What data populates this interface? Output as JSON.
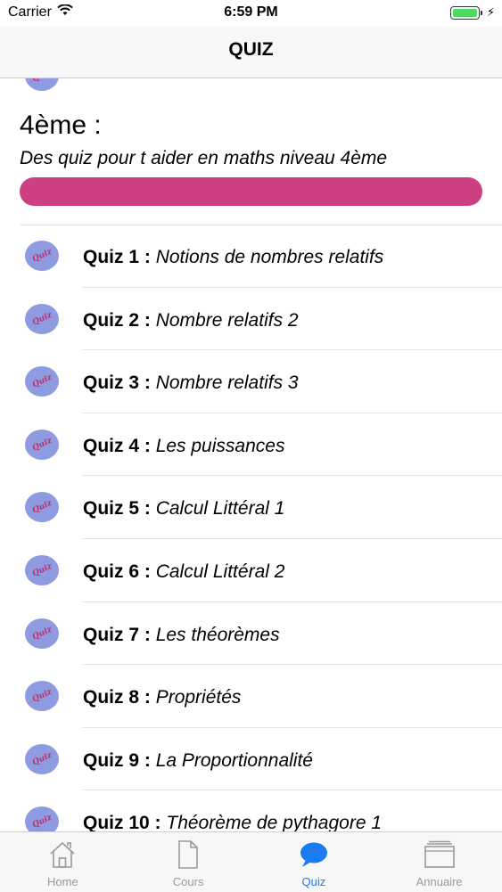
{
  "status_bar": {
    "carrier": "Carrier",
    "time": "6:59 PM"
  },
  "nav": {
    "title": "QUIZ"
  },
  "section": {
    "title": "4ème :",
    "subtitle": "Des quiz pour t aider en maths niveau 4ème",
    "progress_color": "#cc4081"
  },
  "avatar_text": "Quiz",
  "quizzes": [
    {
      "prefix": "Quiz 1 :",
      "title": "Notions de nombres relatifs"
    },
    {
      "prefix": "Quiz 2 :",
      "title": "Nombre relatifs 2"
    },
    {
      "prefix": "Quiz 3 :",
      "title": "Nombre relatifs 3"
    },
    {
      "prefix": "Quiz 4 :",
      "title": "Les puissances"
    },
    {
      "prefix": "Quiz 5 :",
      "title": "Calcul Littéral 1"
    },
    {
      "prefix": "Quiz 6 :",
      "title": "Calcul Littéral 2"
    },
    {
      "prefix": "Quiz 7 :",
      "title": "Les théorèmes"
    },
    {
      "prefix": "Quiz 8 :",
      "title": "Propriétés"
    },
    {
      "prefix": "Quiz 9 :",
      "title": "La Proportionnalité"
    },
    {
      "prefix": "Quiz 10 :",
      "title": "Théorème de pythagore 1"
    }
  ],
  "tabs": [
    {
      "label": "Home",
      "icon": "home-icon",
      "active": false
    },
    {
      "label": "Cours",
      "icon": "document-icon",
      "active": false
    },
    {
      "label": "Quiz",
      "icon": "chat-bubble-icon",
      "active": true
    },
    {
      "label": "Annuaire",
      "icon": "folder-icon",
      "active": false
    }
  ],
  "colors": {
    "accent": "#1a7cf0",
    "progress": "#cc4081",
    "avatar": "#8f9be0",
    "battery": "#4cd964"
  }
}
